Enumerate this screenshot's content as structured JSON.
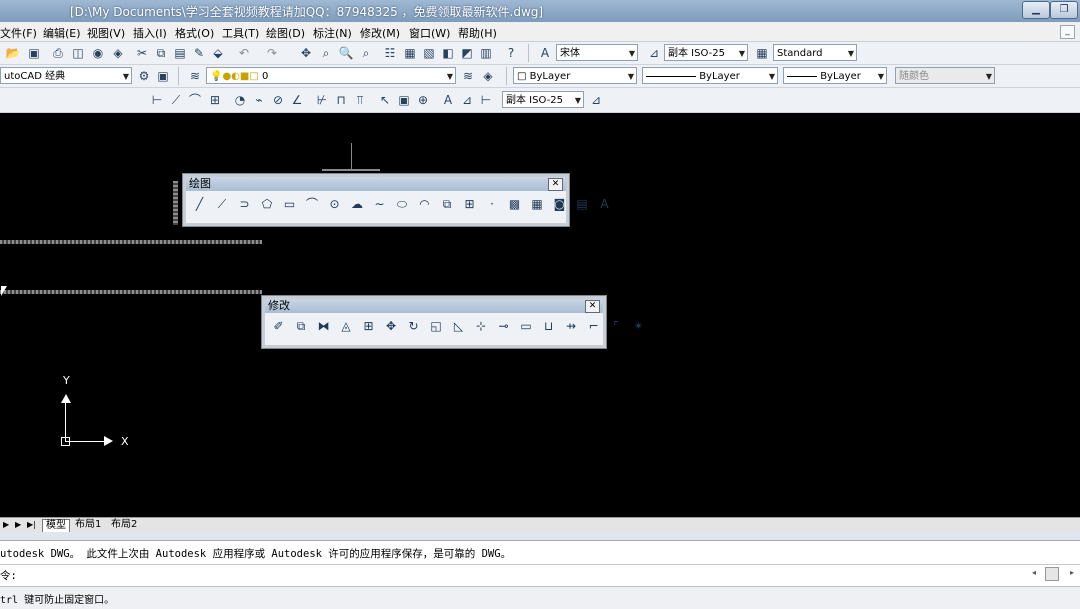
{
  "window": {
    "title": "[D:\\My Documents\\学习全套视频教程请加QQ：87948325 ，免费领取最新软件.dwg]"
  },
  "menu": [
    "文件(F)",
    "编辑(E)",
    "视图(V)",
    "插入(I)",
    "格式(O)",
    "工具(T)",
    "绘图(D)",
    "标注(N)",
    "修改(M)",
    "窗口(W)",
    "帮助(H)"
  ],
  "toolbar1": {
    "text_style_font": "宋体",
    "dim_style": "副本 ISO-25",
    "table_style": "Standard"
  },
  "toolbar2": {
    "workspace": "utoCAD 经典",
    "layer": "0",
    "color": "ByLayer",
    "linetype": "ByLayer",
    "lineweight": "ByLayer",
    "plotstyle": "随颜色"
  },
  "toolbar3": {
    "dim_style": "副本 ISO-25"
  },
  "draw_toolbar": {
    "title": "绘图",
    "close": "✕"
  },
  "modify_toolbar": {
    "title": "修改",
    "close": "✕"
  },
  "ucs": {
    "x_label": "X",
    "y_label": "Y"
  },
  "layout_tabs": {
    "model": "模型",
    "layout1": "布局1",
    "layout2": "布局2"
  },
  "command": {
    "history": "utodesk DWG。   此文件上次由 Autodesk 应用程序或 Autodesk 许可的应用程序保存，是可靠的 DWG。",
    "prompt": "令:"
  },
  "status": {
    "message": "trl 键可防止固定窗口。"
  }
}
